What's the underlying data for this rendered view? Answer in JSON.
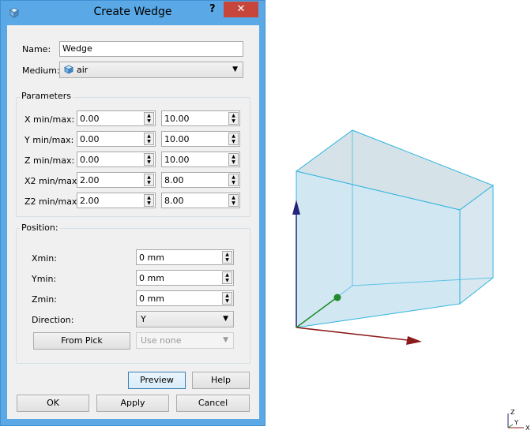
{
  "dialog": {
    "title": "Create Wedge",
    "help_glyph": "?",
    "close_glyph": "✕",
    "name_label": "Name:",
    "name_value": "Wedge",
    "medium_label": "Medium:",
    "medium_value": "air",
    "parameters": {
      "title": "Parameters",
      "rows": [
        {
          "label": "X min/max:",
          "min": "0.00",
          "max": "10.00"
        },
        {
          "label": "Y min/max:",
          "min": "0.00",
          "max": "10.00"
        },
        {
          "label": "Z min/max:",
          "min": "0.00",
          "max": "10.00"
        },
        {
          "label": "X2 min/max:",
          "min": "2.00",
          "max": "8.00"
        },
        {
          "label": "Z2 min/max:",
          "min": "2.00",
          "max": "8.00"
        }
      ]
    },
    "position": {
      "title": "Position:",
      "xmin_label": "Xmin:",
      "xmin_value": "0 mm",
      "ymin_label": "Ymin:",
      "ymin_value": "0 mm",
      "zmin_label": "Zmin:",
      "zmin_value": "0 mm",
      "direction_label": "Direction:",
      "direction_value": "Y",
      "from_pick_label": "From Pick",
      "use_none_value": "Use none"
    },
    "buttons": {
      "preview": "Preview",
      "help": "Help",
      "ok": "OK",
      "apply": "Apply",
      "cancel": "Cancel"
    }
  },
  "viewport": {
    "shape_fill": "#c9e3f0",
    "shape_edge": "#2fb5e0",
    "triad": {
      "z": "Z",
      "y": "Y",
      "x": "X"
    }
  },
  "colors": {
    "window_frame": "#5aa9e6",
    "close_button": "#c7463c",
    "axis_x": "#8b1a1a",
    "axis_y": "#1f8a2a",
    "axis_z": "#23237a"
  }
}
